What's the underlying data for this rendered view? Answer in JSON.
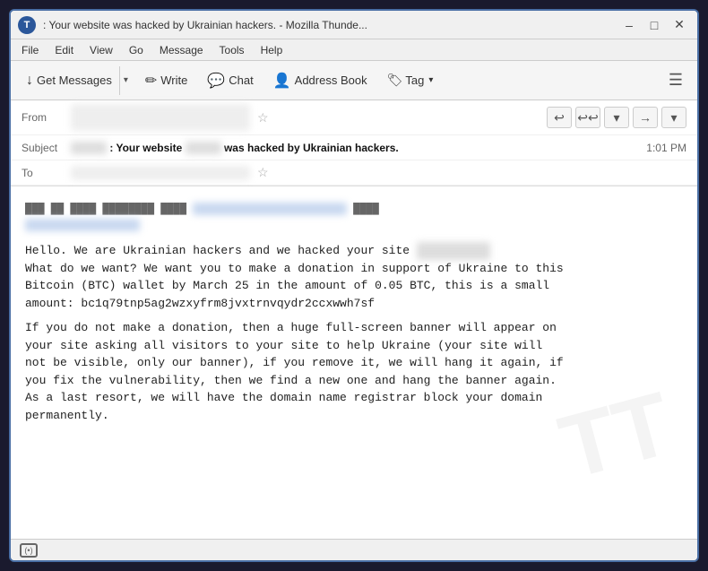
{
  "window": {
    "title": ": Your website  was hacked by Ukrainian hackers. - Mozilla Thunde...",
    "icon": "T"
  },
  "titlebar": {
    "minimize": "–",
    "maximize": "□",
    "close": "✕"
  },
  "menu": {
    "items": [
      "File",
      "Edit",
      "View",
      "Go",
      "Message",
      "Tools",
      "Help"
    ]
  },
  "toolbar": {
    "get_messages": "Get Messages",
    "write": "Write",
    "chat": "Chat",
    "address_book": "Address Book",
    "tag": "Tag",
    "hamburger": "☰"
  },
  "email": {
    "from_label": "From",
    "from_value": "███████ ████████@████.███",
    "subject_label": "Subject",
    "subject_prefix": "████",
    "subject_main": ": Your website",
    "subject_blurred": "████",
    "subject_suffix": "was hacked by Ukrainian hackers.",
    "time": "1:01 PM",
    "to_label": "To",
    "to_value": "████████████",
    "prelude_line1": "███ ██ ████ ████████ ████",
    "prelude_link": "████://████.███.███.███",
    "prelude_extra": "████",
    "prelude_line2": "████████",
    "prelude_link2": "████████@████.███",
    "body": "Hello. We are Ukrainian hackers and we hacked your site",
    "body_blurred": "███████ ██",
    "body_para1": "What do we want? We want you to make a donation in support of Ukraine to this\nBitcoin (BTC) wallet by March 25 in the amount of 0.05 BTC, this is a small\namount: bc1q79tnp5ag2wzxyfrm8jvxtrnvqydr2ccxwwh7sf",
    "body_para2": "If you do not make a donation, then a huge full-screen banner will appear on\nyour site asking all visitors to your site to help Ukraine (your site will\nnot be visible, only our banner), if you remove it, we will hang it again, if\nyou fix the vulnerability, then we find a new one and hang the banner again.\nAs a last resort, we will have the domain name registrar block your domain\npermanently."
  },
  "icons": {
    "get_messages": "↓",
    "write": "✏",
    "chat": "💬",
    "address_book": "👤",
    "tag": "🏷",
    "reply": "↩",
    "reply_all": "↩↩",
    "down": "▾",
    "forward": "→",
    "more": "▾",
    "star": "☆"
  },
  "status_bar": {
    "icon": "(•)"
  }
}
